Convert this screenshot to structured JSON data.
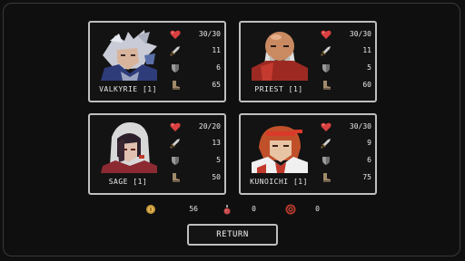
{
  "party": [
    {
      "name": "VALKYRIE [1]",
      "hp": "30/30",
      "attack": "11",
      "defense": "6",
      "speed": "65"
    },
    {
      "name": "PRIEST [1]",
      "hp": "30/30",
      "attack": "11",
      "defense": "5",
      "speed": "60"
    },
    {
      "name": "SAGE [1]",
      "hp": "20/20",
      "attack": "13",
      "defense": "5",
      "speed": "50"
    },
    {
      "name": "KUNOICHI [1]",
      "hp": "30/30",
      "attack": "9",
      "defense": "6",
      "speed": "75"
    }
  ],
  "resources": {
    "gold": "56",
    "potions": "0",
    "target_items": "0"
  },
  "return_label": "RETURN",
  "colors": {
    "heart": "#d94040",
    "gold": "#c99a3a",
    "potion": "#c84a4a",
    "target": "#c0392b",
    "border": "#bfbfbf",
    "background": "#0f0f0f"
  },
  "icons": {
    "hp": "heart-icon",
    "attack": "sword-icon",
    "defense": "shield-icon",
    "speed": "boot-icon"
  }
}
